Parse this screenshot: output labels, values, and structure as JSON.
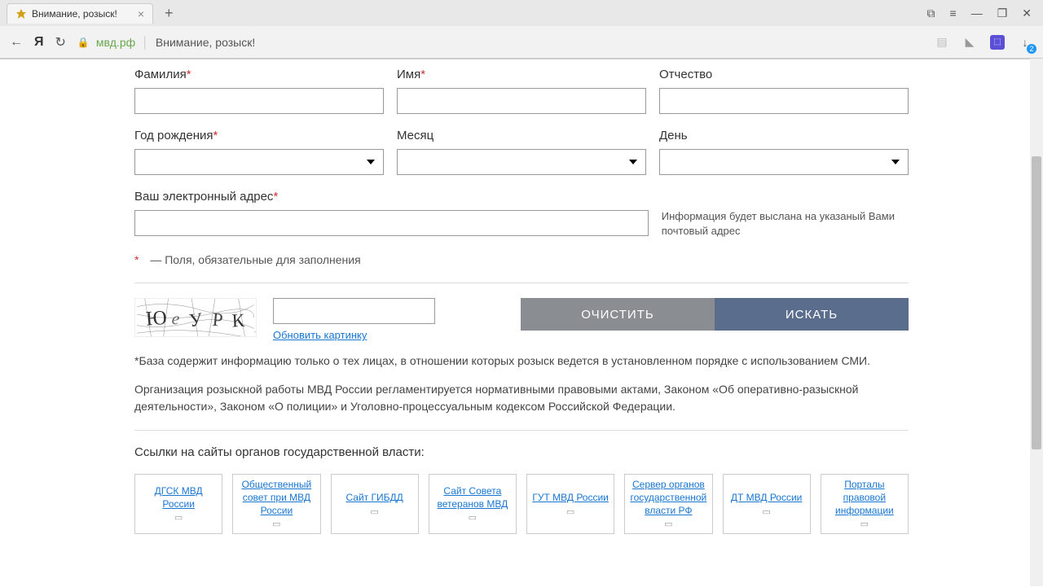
{
  "browser": {
    "tab_title": "Внимание, розыск!",
    "domain": "мвд.рф",
    "page_title": "Внимание, розыск!"
  },
  "form": {
    "surname_label": "Фамилия",
    "name_label": "Имя",
    "patronymic_label": "Отчество",
    "birth_year_label": "Год рождения",
    "month_label": "Месяц",
    "day_label": "День",
    "email_label": "Ваш электронный адрес",
    "email_hint": "Информация будет выслана на указаный Вами почтовый адрес",
    "required_note": " — Поля, обязательные для заполнения",
    "captcha_text": "Ю е У Р К",
    "refresh_captcha": "Обновить картинку",
    "clear_btn": "ОЧИСТИТЬ",
    "search_btn": "ИСКАТЬ"
  },
  "disclaimer": {
    "p1": "*База содержит информацию только о тех лицах, в отношении которых розыск ведется в установленном порядке с использованием СМИ.",
    "p2": "Организация розыскной работы МВД России регламентируется нормативными правовыми актами, Законом «Об оперативно-разыскной деятельности», Законом «О полиции» и Уголовно-процессуальным кодексом Российской Федерации."
  },
  "links": {
    "heading": "Ссылки на сайты органов государственной власти:",
    "items": [
      {
        "label": "ДГСК МВД России"
      },
      {
        "label": "Общественный совет при МВД России"
      },
      {
        "label": "Сайт ГИБДД"
      },
      {
        "label": "Сайт Совета ветеранов МВД"
      },
      {
        "label": "ГУТ МВД России"
      },
      {
        "label": "Сервер органов государственной власти РФ"
      },
      {
        "label": "ДТ МВД России"
      },
      {
        "label": "Порталы правовой информации"
      }
    ]
  }
}
